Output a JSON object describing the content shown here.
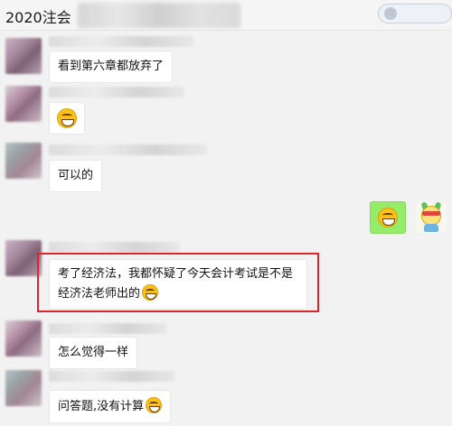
{
  "window": {
    "title": "2020注会"
  },
  "messages": [
    {
      "text": "看到第六章都放弃了"
    },
    {
      "emoji": "laughing-face-emoji"
    },
    {
      "text": "可以的"
    },
    {
      "emoji": "rolling-laughing-emoji",
      "from_self": true
    },
    {
      "text": "考了经济法，我都怀疑了今天会计考试是不是经济法老师出的",
      "emoji": "grinning-face-emoji",
      "highlighted": true
    },
    {
      "text": "怎么觉得一样"
    },
    {
      "text": "问答题,没有计算",
      "emoji": "grinning-face-emoji"
    }
  ],
  "colors": {
    "highlight": "#e0242c",
    "self_bubble": "#95ec69",
    "background": "#f2f2f2"
  }
}
